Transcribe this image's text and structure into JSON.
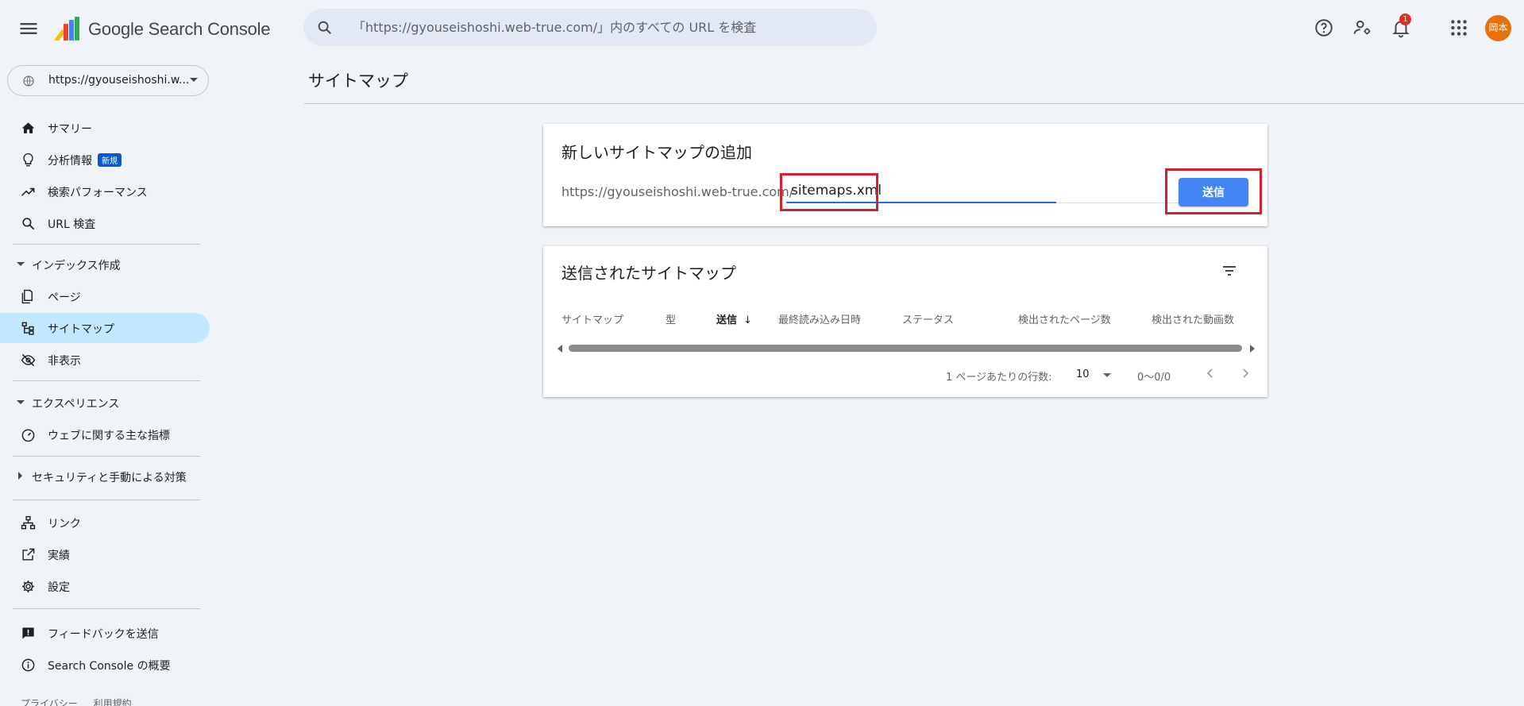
{
  "app": {
    "title": "Google Search Console",
    "search_placeholder": "「https://gyouseishoshi.web-true.com/」内のすべての URL を検査",
    "notification_count": "1",
    "avatar_text": "岡本"
  },
  "property": {
    "label": "https://gyouseishoshi.w..."
  },
  "sidebar": {
    "items": [
      {
        "label": "サマリー",
        "icon": "home-icon"
      },
      {
        "label": "分析情報",
        "icon": "lightbulb-icon",
        "badge": "新規"
      },
      {
        "label": "検索パフォーマンス",
        "icon": "trending-up-icon"
      },
      {
        "label": "URL 検査",
        "icon": "search-icon"
      }
    ],
    "index_section": {
      "label": "インデックス作成",
      "items": [
        {
          "label": "ページ",
          "icon": "pages-icon"
        },
        {
          "label": "サイトマップ",
          "icon": "sitemap-icon",
          "active": true
        },
        {
          "label": "非表示",
          "icon": "visibility-off-icon"
        }
      ]
    },
    "experience_section": {
      "label": "エクスペリエンス",
      "items": [
        {
          "label": "ウェブに関する主な指標",
          "icon": "speed-gauge-icon"
        }
      ]
    },
    "security_section": {
      "label": "セキュリティと手動による対策"
    },
    "misc_items": [
      {
        "label": "リンク",
        "icon": "links-icon"
      },
      {
        "label": "実績",
        "icon": "open-in-new-icon"
      },
      {
        "label": "設定",
        "icon": "gear-icon"
      }
    ],
    "bottom_items": [
      {
        "label": "フィードバックを送信",
        "icon": "feedback-icon"
      },
      {
        "label": "Search Console の概要",
        "icon": "info-icon"
      }
    ],
    "footer": {
      "privacy": "プライバシー",
      "terms": "利用規約"
    }
  },
  "main": {
    "page_title": "サイトマップ",
    "add_card": {
      "title": "新しいサイトマップの追加",
      "url_prefix": "https://gyouseishoshi.web-true.com/",
      "input_value": "sitemaps.xml",
      "submit_label": "送信"
    },
    "submitted_card": {
      "title": "送信されたサイトマップ",
      "columns": [
        "サイトマップ",
        "型",
        "送信",
        "最終読み込み日時",
        "ステータス",
        "検出されたページ数",
        "検出された動画数"
      ],
      "sort_arrow": "↓",
      "rows_per_page_label": "1 ページあたりの行数:",
      "rows_per_page_value": "10",
      "range": "0〜0/0"
    }
  },
  "colors": {
    "background": "#f0f4f9",
    "accent": "#4285f4",
    "active_nav": "#c2e7ff",
    "highlight_annotation": "#d3222e"
  }
}
